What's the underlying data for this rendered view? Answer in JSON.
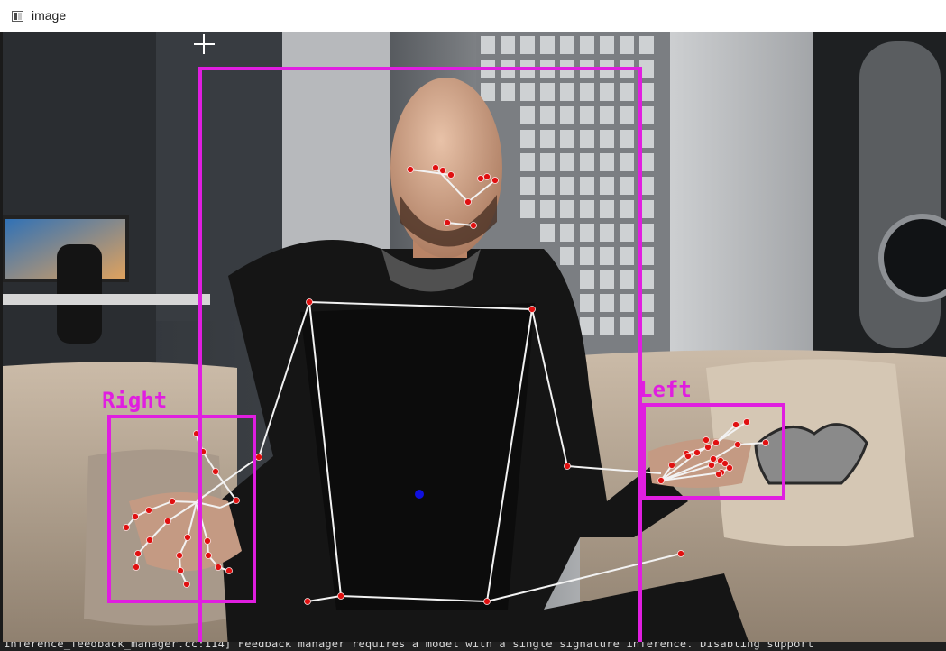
{
  "window": {
    "title": "image",
    "icon": "window-app-icon"
  },
  "overlay": {
    "hand_labels": {
      "right": "Right",
      "left": "Left"
    },
    "colors": {
      "bbox": "#e01ee0",
      "skeleton": "#f2f2f2",
      "keypoint": "#e01010",
      "center": "#1010e0",
      "cursor": "#ffffff"
    }
  },
  "console": {
    "text": "inference_feedback_manager.cc:114] Feedback manager requires a model with a single signature inference. Disabling support"
  }
}
